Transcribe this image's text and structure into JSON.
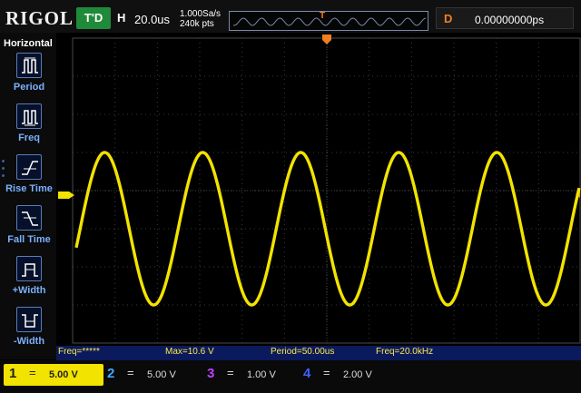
{
  "header": {
    "brand": "RIGOL",
    "trigger_status": "T'D",
    "horizontal_letter": "H",
    "horizontal_scale": "20.0us",
    "sample_rate": "1.000Sa/s",
    "memory_depth": "240k pts",
    "delay_letter": "D",
    "delay_value": "0.00000000ps"
  },
  "menu": {
    "title": "Horizontal",
    "items": [
      {
        "label": "Period",
        "icon": "period-icon"
      },
      {
        "label": "Freq",
        "icon": "freq-icon"
      },
      {
        "label": "Rise Time",
        "icon": "rise-time-icon"
      },
      {
        "label": "Fall Time",
        "icon": "fall-time-icon"
      },
      {
        "label": "+Width",
        "icon": "pos-width-icon"
      },
      {
        "label": "-Width",
        "icon": "neg-width-icon"
      }
    ]
  },
  "measurements": {
    "freq": "Freq=*****",
    "max": "Max=10.6 V",
    "period": "Period=50.00us",
    "freq2": "Freq=20.0kHz"
  },
  "channels": [
    {
      "num": "1",
      "sep": "=",
      "scale": "5.00 V"
    },
    {
      "num": "2",
      "sep": "=",
      "scale": "5.00 V"
    },
    {
      "num": "3",
      "sep": "=",
      "scale": "1.00 V"
    },
    {
      "num": "4",
      "sep": "=",
      "scale": "2.00 V"
    }
  ],
  "colors": {
    "ch1": "#f2e300",
    "ch2": "#40a8ff",
    "ch3": "#c040ff",
    "ch4": "#4060ff",
    "trigger": "#f08020"
  }
}
